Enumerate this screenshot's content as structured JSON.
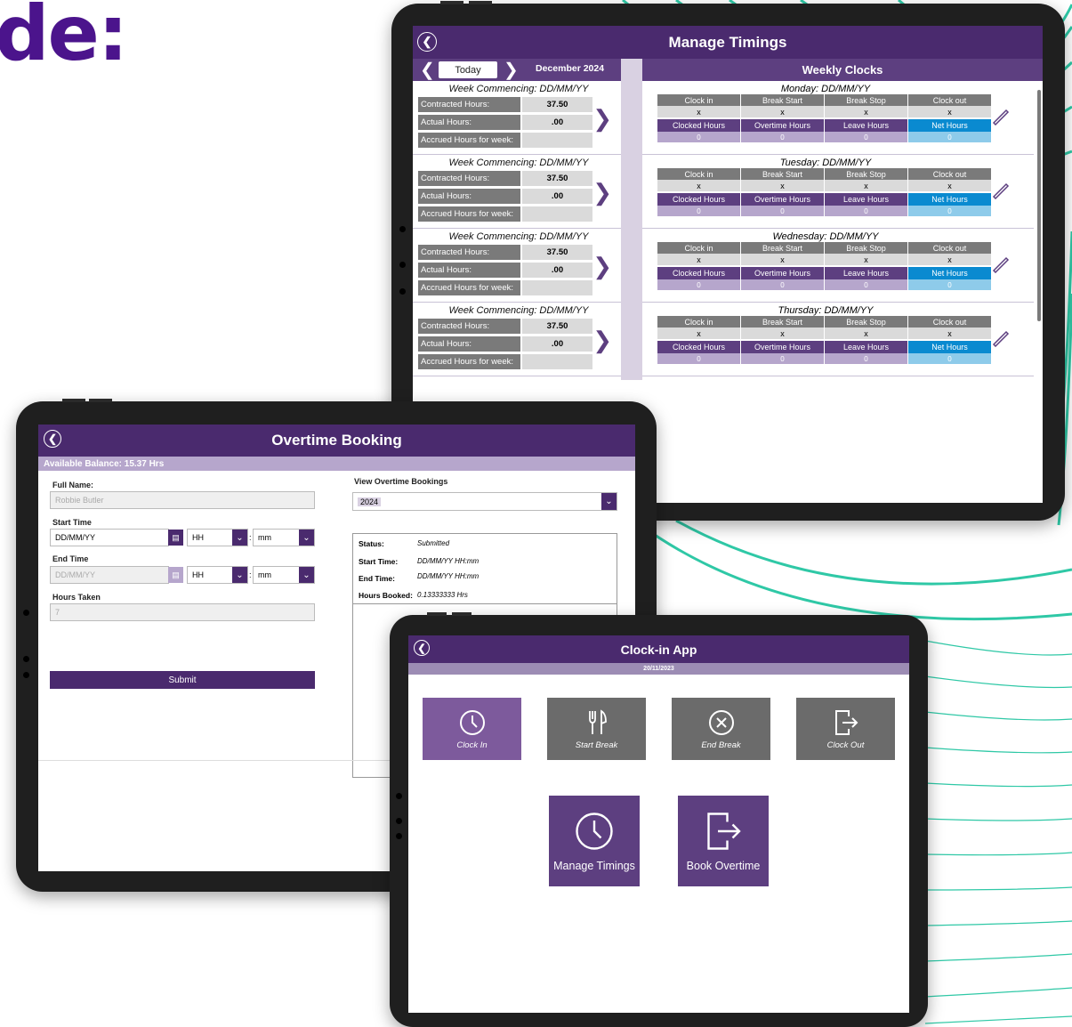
{
  "headline": "de:",
  "colors": {
    "purple_dark": "#4a2a6e",
    "purple_mid": "#5d3f80",
    "purple_light": "#b6a6cc",
    "accent_blue": "#0a8ad0",
    "teal_curves": "#2fc8a6",
    "grey_tile": "#6b6b6b"
  },
  "manage_timings": {
    "title": "Manage Timings",
    "back_icon": "back-circle-icon",
    "today_label": "Today",
    "month": "December 2024",
    "weekly_clocks_title": "Weekly Clocks",
    "weeks": [
      {
        "title": "Week Commencing: DD/MM/YY",
        "contracted_label": "Contracted Hours:",
        "contracted": "37.50",
        "actual_label": "Actual Hours:",
        "actual": ".00",
        "accrued_label": "Accrued Hours for week:",
        "accrued": ""
      },
      {
        "title": "Week Commencing: DD/MM/YY",
        "contracted_label": "Contracted Hours:",
        "contracted": "37.50",
        "actual_label": "Actual Hours:",
        "actual": ".00",
        "accrued_label": "Accrued Hours for week:",
        "accrued": ""
      },
      {
        "title": "Week Commencing: DD/MM/YY",
        "contracted_label": "Contracted Hours:",
        "contracted": "37.50",
        "actual_label": "Actual Hours:",
        "actual": ".00",
        "accrued_label": "Accrued Hours for week:",
        "accrued": ""
      },
      {
        "title": "Week Commencing: DD/MM/YY",
        "contracted_label": "Contracted Hours:",
        "contracted": "37.50",
        "actual_label": "Actual Hours:",
        "actual": ".00",
        "accrued_label": "Accrued Hours for week:",
        "accrued": ""
      }
    ],
    "clock_headers": [
      "Clock in",
      "Break Start",
      "Break Stop",
      "Clock out"
    ],
    "hour_headers": [
      "Clocked Hours",
      "Overtime Hours",
      "Leave Hours",
      "Net Hours"
    ],
    "days": [
      {
        "title": "Monday: DD/MM/YY",
        "clock_values": [
          "x",
          "x",
          "x",
          "x"
        ],
        "hour_values": [
          "0",
          "0",
          "0",
          "0"
        ]
      },
      {
        "title": "Tuesday: DD/MM/YY",
        "clock_values": [
          "x",
          "x",
          "x",
          "x"
        ],
        "hour_values": [
          "0",
          "0",
          "0",
          "0"
        ]
      },
      {
        "title": "Wednesday: DD/MM/YY",
        "clock_values": [
          "x",
          "x",
          "x",
          "x"
        ],
        "hour_values": [
          "0",
          "0",
          "0",
          "0"
        ]
      },
      {
        "title": "Thursday: DD/MM/YY",
        "clock_values": [
          "x",
          "x",
          "x",
          "x"
        ],
        "hour_values": [
          "0",
          "0",
          "0",
          "0"
        ]
      }
    ]
  },
  "overtime": {
    "title": "Overtime Booking",
    "balance": "Available Balance: 15.37 Hrs",
    "full_name_label": "Full Name:",
    "full_name_value": "Robbie Butler",
    "start_time_label": "Start Time",
    "start_date": "DD/MM/YY",
    "start_hh": "HH",
    "start_mm": "mm",
    "end_time_label": "End Time",
    "end_date": "DD/MM/YY",
    "end_hh": "HH",
    "end_mm": "mm",
    "colon": ":",
    "hours_taken_label": "Hours Taken",
    "hours_taken_value": "7",
    "submit_label": "Submit",
    "view_label": "View Overtime Bookings",
    "year_selected": "2024",
    "status_label": "Status:",
    "status_value": "Submitted",
    "start_label": "Start Time:",
    "start_value": "DD/MM/YY  HH:mm",
    "end_label": "End Time:",
    "end_value": "DD/MM/YY  HH:mm",
    "hours_booked_label": "Hours Booked:",
    "hours_booked_value": "0.13333333 Hrs"
  },
  "clockin": {
    "title": "Clock-in App",
    "date": "20/11/2023",
    "tiles": [
      {
        "label": "Clock In",
        "icon": "clock-icon"
      },
      {
        "label": "Start Break",
        "icon": "fork-knife-icon"
      },
      {
        "label": "End Break",
        "icon": "close-circle-icon"
      },
      {
        "label": "Clock Out",
        "icon": "exit-icon"
      }
    ],
    "big_tiles": [
      {
        "label": "Manage Timings",
        "icon": "clock-icon"
      },
      {
        "label": "Book Overtime",
        "icon": "exit-icon"
      }
    ]
  }
}
